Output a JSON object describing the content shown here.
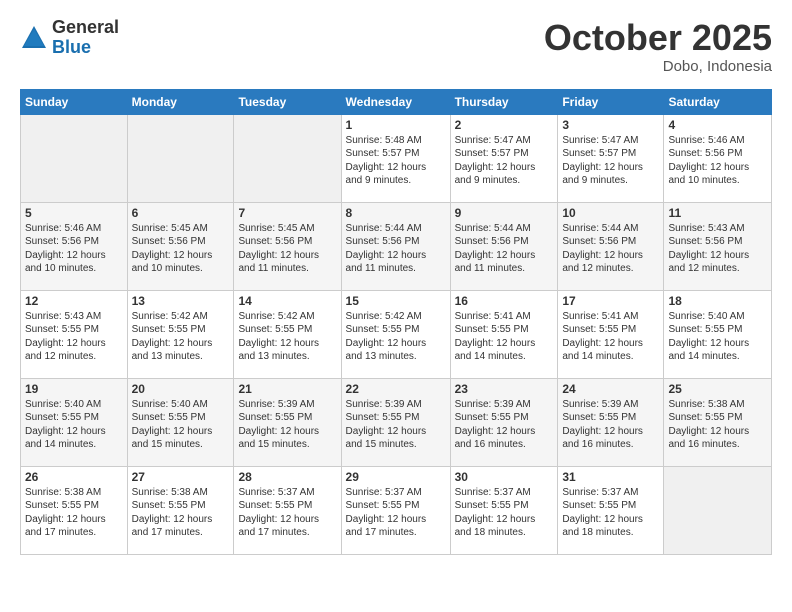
{
  "logo": {
    "general": "General",
    "blue": "Blue"
  },
  "title": "October 2025",
  "location": "Dobo, Indonesia",
  "days_header": [
    "Sunday",
    "Monday",
    "Tuesday",
    "Wednesday",
    "Thursday",
    "Friday",
    "Saturday"
  ],
  "weeks": [
    [
      {
        "num": "",
        "info": ""
      },
      {
        "num": "",
        "info": ""
      },
      {
        "num": "",
        "info": ""
      },
      {
        "num": "1",
        "info": "Sunrise: 5:48 AM\nSunset: 5:57 PM\nDaylight: 12 hours\nand 9 minutes."
      },
      {
        "num": "2",
        "info": "Sunrise: 5:47 AM\nSunset: 5:57 PM\nDaylight: 12 hours\nand 9 minutes."
      },
      {
        "num": "3",
        "info": "Sunrise: 5:47 AM\nSunset: 5:57 PM\nDaylight: 12 hours\nand 9 minutes."
      },
      {
        "num": "4",
        "info": "Sunrise: 5:46 AM\nSunset: 5:56 PM\nDaylight: 12 hours\nand 10 minutes."
      }
    ],
    [
      {
        "num": "5",
        "info": "Sunrise: 5:46 AM\nSunset: 5:56 PM\nDaylight: 12 hours\nand 10 minutes."
      },
      {
        "num": "6",
        "info": "Sunrise: 5:45 AM\nSunset: 5:56 PM\nDaylight: 12 hours\nand 10 minutes."
      },
      {
        "num": "7",
        "info": "Sunrise: 5:45 AM\nSunset: 5:56 PM\nDaylight: 12 hours\nand 11 minutes."
      },
      {
        "num": "8",
        "info": "Sunrise: 5:44 AM\nSunset: 5:56 PM\nDaylight: 12 hours\nand 11 minutes."
      },
      {
        "num": "9",
        "info": "Sunrise: 5:44 AM\nSunset: 5:56 PM\nDaylight: 12 hours\nand 11 minutes."
      },
      {
        "num": "10",
        "info": "Sunrise: 5:44 AM\nSunset: 5:56 PM\nDaylight: 12 hours\nand 12 minutes."
      },
      {
        "num": "11",
        "info": "Sunrise: 5:43 AM\nSunset: 5:56 PM\nDaylight: 12 hours\nand 12 minutes."
      }
    ],
    [
      {
        "num": "12",
        "info": "Sunrise: 5:43 AM\nSunset: 5:55 PM\nDaylight: 12 hours\nand 12 minutes."
      },
      {
        "num": "13",
        "info": "Sunrise: 5:42 AM\nSunset: 5:55 PM\nDaylight: 12 hours\nand 13 minutes."
      },
      {
        "num": "14",
        "info": "Sunrise: 5:42 AM\nSunset: 5:55 PM\nDaylight: 12 hours\nand 13 minutes."
      },
      {
        "num": "15",
        "info": "Sunrise: 5:42 AM\nSunset: 5:55 PM\nDaylight: 12 hours\nand 13 minutes."
      },
      {
        "num": "16",
        "info": "Sunrise: 5:41 AM\nSunset: 5:55 PM\nDaylight: 12 hours\nand 14 minutes."
      },
      {
        "num": "17",
        "info": "Sunrise: 5:41 AM\nSunset: 5:55 PM\nDaylight: 12 hours\nand 14 minutes."
      },
      {
        "num": "18",
        "info": "Sunrise: 5:40 AM\nSunset: 5:55 PM\nDaylight: 12 hours\nand 14 minutes."
      }
    ],
    [
      {
        "num": "19",
        "info": "Sunrise: 5:40 AM\nSunset: 5:55 PM\nDaylight: 12 hours\nand 14 minutes."
      },
      {
        "num": "20",
        "info": "Sunrise: 5:40 AM\nSunset: 5:55 PM\nDaylight: 12 hours\nand 15 minutes."
      },
      {
        "num": "21",
        "info": "Sunrise: 5:39 AM\nSunset: 5:55 PM\nDaylight: 12 hours\nand 15 minutes."
      },
      {
        "num": "22",
        "info": "Sunrise: 5:39 AM\nSunset: 5:55 PM\nDaylight: 12 hours\nand 15 minutes."
      },
      {
        "num": "23",
        "info": "Sunrise: 5:39 AM\nSunset: 5:55 PM\nDaylight: 12 hours\nand 16 minutes."
      },
      {
        "num": "24",
        "info": "Sunrise: 5:39 AM\nSunset: 5:55 PM\nDaylight: 12 hours\nand 16 minutes."
      },
      {
        "num": "25",
        "info": "Sunrise: 5:38 AM\nSunset: 5:55 PM\nDaylight: 12 hours\nand 16 minutes."
      }
    ],
    [
      {
        "num": "26",
        "info": "Sunrise: 5:38 AM\nSunset: 5:55 PM\nDaylight: 12 hours\nand 17 minutes."
      },
      {
        "num": "27",
        "info": "Sunrise: 5:38 AM\nSunset: 5:55 PM\nDaylight: 12 hours\nand 17 minutes."
      },
      {
        "num": "28",
        "info": "Sunrise: 5:37 AM\nSunset: 5:55 PM\nDaylight: 12 hours\nand 17 minutes."
      },
      {
        "num": "29",
        "info": "Sunrise: 5:37 AM\nSunset: 5:55 PM\nDaylight: 12 hours\nand 17 minutes."
      },
      {
        "num": "30",
        "info": "Sunrise: 5:37 AM\nSunset: 5:55 PM\nDaylight: 12 hours\nand 18 minutes."
      },
      {
        "num": "31",
        "info": "Sunrise: 5:37 AM\nSunset: 5:55 PM\nDaylight: 12 hours\nand 18 minutes."
      },
      {
        "num": "",
        "info": ""
      }
    ]
  ]
}
